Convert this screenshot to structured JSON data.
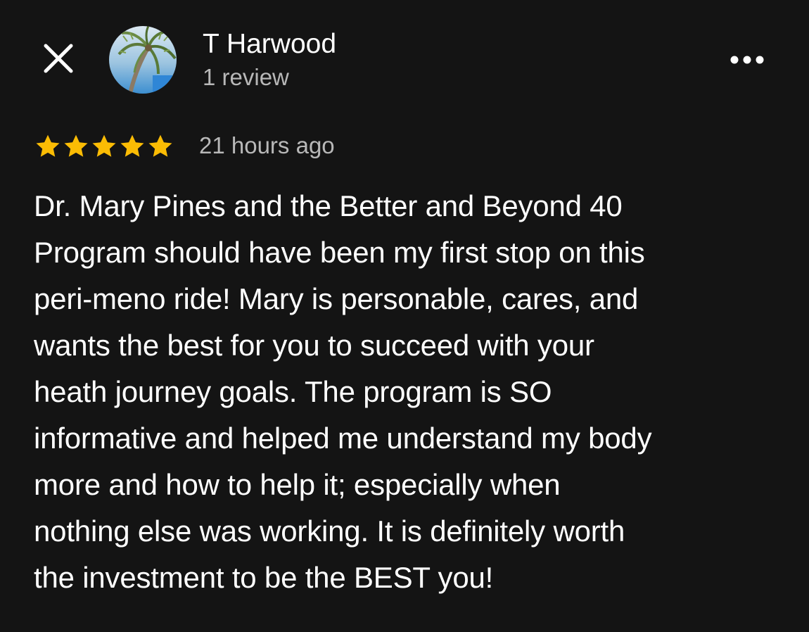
{
  "header": {
    "close_icon": "close-icon",
    "avatar_icon": "avatar-palm-tree",
    "reviewer_name": "T Harwood",
    "review_count": "1 review",
    "more_icon": "more-horizontal-icon"
  },
  "review": {
    "rating": 5,
    "rating_max": 5,
    "star_color": "#fbbc04",
    "timestamp": "21 hours ago",
    "text": "Dr. Mary Pines and the Better and Beyond 40\nProgram should have been my first stop on this\nperi-meno ride!  Mary is personable, cares, and\nwants the best for you to succeed with your\nheath journey goals.  The program is SO\ninformative and helped me understand my body\nmore and how to help it; especially when\nnothing else was working.  It is definitely worth\nthe investment to be the BEST you!"
  },
  "colors": {
    "background": "#141414",
    "primary_text": "#ffffff",
    "secondary_text": "#b8b8b8",
    "star": "#fbbc04"
  }
}
